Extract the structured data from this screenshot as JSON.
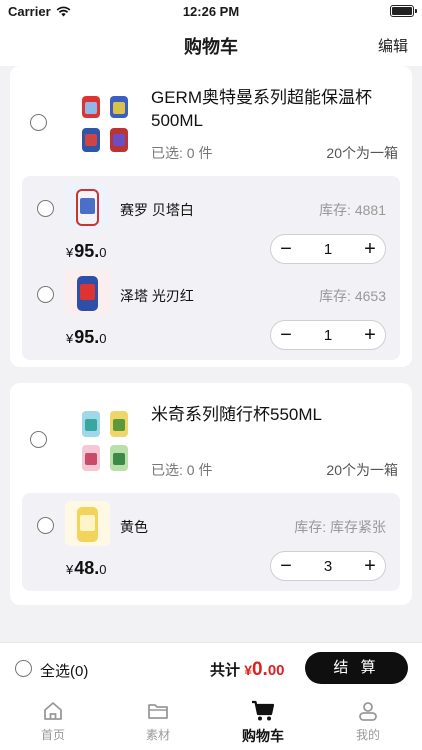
{
  "status_bar": {
    "carrier": "Carrier",
    "time": "12:26 PM"
  },
  "nav": {
    "title": "购物车",
    "edit_label": "编辑"
  },
  "products": [
    {
      "name": "GERM奥特曼系列超能保温杯500ML",
      "selected": "已选: 0 件",
      "pack": "20个为一箱",
      "variants": [
        {
          "name": "赛罗 贝塔白",
          "stock": "库存: 4881",
          "price_symbol": "¥",
          "price_int": "95.",
          "price_dec": "0",
          "qty": "1"
        },
        {
          "name": "泽塔 光刃红",
          "stock": "库存: 4653",
          "price_symbol": "¥",
          "price_int": "95.",
          "price_dec": "0",
          "qty": "1"
        }
      ]
    },
    {
      "name": "米奇系列随行杯550ML",
      "selected": "已选: 0 件",
      "pack": "20个为一箱",
      "variants": [
        {
          "name": "黄色",
          "stock": "库存: 库存紧张",
          "price_symbol": "¥",
          "price_int": "48.",
          "price_dec": "0",
          "qty": "3"
        }
      ]
    }
  ],
  "footer": {
    "select_all": "全选(0)",
    "total_label": "共计",
    "total_symbol": "¥",
    "total_int": "0.",
    "total_dec": "00",
    "checkout_label": "结 算"
  },
  "tabs": [
    {
      "label": "首页",
      "icon": "home-icon"
    },
    {
      "label": "素材",
      "icon": "folder-icon"
    },
    {
      "label": "购物车",
      "icon": "cart-icon"
    },
    {
      "label": "我的",
      "icon": "user-icon"
    }
  ],
  "active_tab": "购物车",
  "colors": {
    "accent": "#e02020",
    "checkout_bg": "#0f0f0f"
  }
}
